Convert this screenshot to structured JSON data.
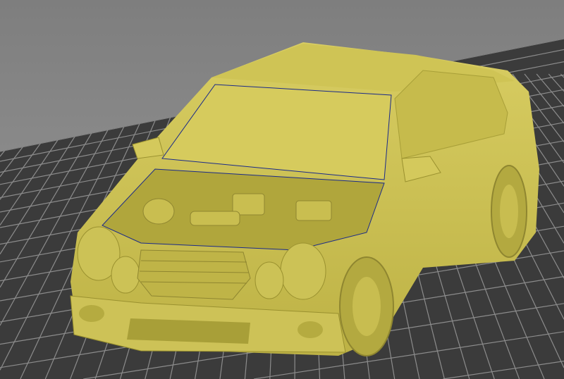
{
  "viewport": {
    "background_color": "#8a8a8a",
    "bed_color": "#3b3b3b",
    "grid_line_color": "#8c8c8c",
    "model_color": "#d2c75a",
    "model_shadow_color": "#a89f38",
    "edge_highlight_color": "#1a2a8a"
  }
}
